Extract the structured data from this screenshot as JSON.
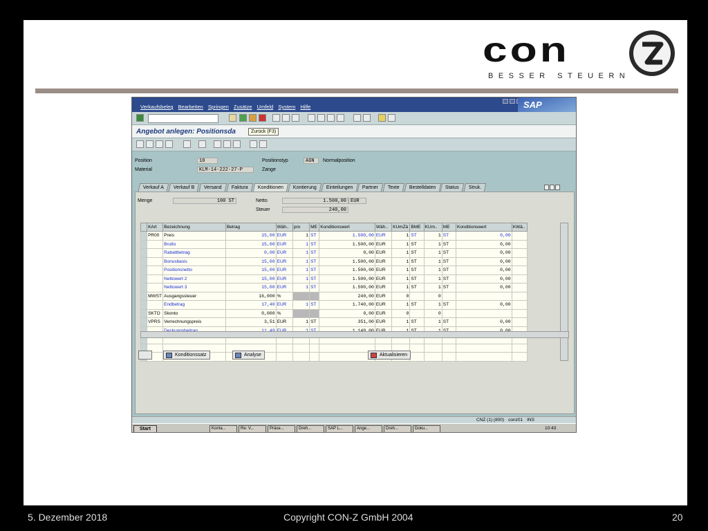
{
  "logo": {
    "word": "con",
    "tagline": "BESSER STEUERN"
  },
  "sap": {
    "menu": [
      "Verkaufsbeleg",
      "Bearbeiten",
      "Springen",
      "Zusätze",
      "Umfeld",
      "System",
      "Hilfe"
    ],
    "brand": "SAP",
    "title": "Angebot anlegen: Positionsda",
    "tooltip": "Zurück  (F3)",
    "header": {
      "position_label": "Position",
      "position_value": "10",
      "material_label": "Material",
      "material_value": "KLM-14-222-27-P",
      "postyp_label": "Positionstyp",
      "postyp_value": "AGN",
      "postyp_text": "Normalposition",
      "material_text": "Zange"
    },
    "tabs": [
      "Verkauf A",
      "Verkauf B",
      "Versand",
      "Faktura",
      "Konditionen",
      "Kontierung",
      "Einteilungen",
      "Partner",
      "Texte",
      "Bestelldaten",
      "Status",
      "Struk."
    ],
    "active_tab": "Konditionen",
    "summary": {
      "menge_label": "Menge",
      "menge_value": "100 ST",
      "netto_label": "Netto",
      "netto_value": "1.500,00",
      "netto_currency": "EUR",
      "steuer_label": "Steuer",
      "steuer_value": "240,00"
    },
    "table": {
      "columns": [
        "KArt",
        "Bezeichnung",
        "Betrag",
        "Wäh..",
        "pro",
        "ME",
        "Konditionswert",
        "Wäh..",
        "KUmZä",
        "BME",
        "KUm..",
        "ME",
        "Konditionswert",
        "KWä.."
      ],
      "rows": [
        [
          "PR00",
          "Preis",
          "15,00",
          "EUR",
          "1",
          "ST",
          "1.500,00",
          "EUR",
          "1",
          "ST",
          "1",
          "ST",
          "0,00",
          ""
        ],
        [
          "",
          "Brutto",
          "15,00",
          "EUR",
          "1",
          "ST",
          "1.500,00",
          "EUR",
          "1",
          "ST",
          "1",
          "ST",
          "0,00",
          ""
        ],
        [
          "",
          "Rabattbetrag",
          "0,00",
          "EUR",
          "1",
          "ST",
          "0,00",
          "EUR",
          "1",
          "ST",
          "1",
          "ST",
          "0,00",
          ""
        ],
        [
          "",
          "Bonusbasis",
          "15,00",
          "EUR",
          "1",
          "ST",
          "1.500,00",
          "EUR",
          "1",
          "ST",
          "1",
          "ST",
          "0,00",
          ""
        ],
        [
          "",
          "Positionsnetto",
          "15,00",
          "EUR",
          "1",
          "ST",
          "1.500,00",
          "EUR",
          "1",
          "ST",
          "1",
          "ST",
          "0,00",
          ""
        ],
        [
          "",
          "Nettowert 2",
          "15,00",
          "EUR",
          "1",
          "ST",
          "1.500,00",
          "EUR",
          "1",
          "ST",
          "1",
          "ST",
          "0,00",
          ""
        ],
        [
          "",
          "Nettowert 3",
          "15,00",
          "EUR",
          "1",
          "ST",
          "1.500,00",
          "EUR",
          "1",
          "ST",
          "1",
          "ST",
          "0,00",
          ""
        ],
        [
          "MWST",
          "Ausgangssteuer",
          "16,000",
          "%",
          "",
          "",
          "240,00",
          "EUR",
          "0",
          "",
          "0",
          "",
          "",
          ""
        ],
        [
          "",
          "Endbetrag",
          "17,40",
          "EUR",
          "1",
          "ST",
          "1.740,00",
          "EUR",
          "1",
          "ST",
          "1",
          "ST",
          "0,00",
          ""
        ],
        [
          "SKTO",
          "Skonto",
          "0,000",
          "%",
          "",
          "",
          "0,00",
          "EUR",
          "0",
          "",
          "0",
          "",
          "",
          ""
        ],
        [
          "VPRS",
          "Verrechnungspreis",
          "3,51",
          "EUR",
          "1",
          "ST",
          "351,00",
          "EUR",
          "1",
          "ST",
          "1",
          "ST",
          "0,00",
          ""
        ],
        [
          "",
          "Deckungsbeitrag",
          "11,49",
          "EUR",
          "1",
          "ST",
          "1.149,00",
          "EUR",
          "1",
          "ST",
          "1",
          "ST",
          "0,00",
          ""
        ]
      ]
    },
    "buttons": {
      "konditionssatz": "Konditionssatz",
      "analyse": "Analyse",
      "aktualisieren": "Aktualisieren"
    },
    "status": {
      "system": "CNZ (1) (800)",
      "server": "conz01",
      "mode": "INS"
    },
    "taskbar": {
      "start": "Start",
      "tasks": [
        "Konta...",
        "Re: V...",
        "Präse...",
        "Dreh...",
        "SAP L...",
        "Ange...",
        "Dreh...",
        "Doku..."
      ],
      "clock": "10:43"
    }
  },
  "footer": {
    "date": "5. Dezember 2018",
    "copyright": "Copyright CON-Z GmbH 2004",
    "page": "20"
  }
}
